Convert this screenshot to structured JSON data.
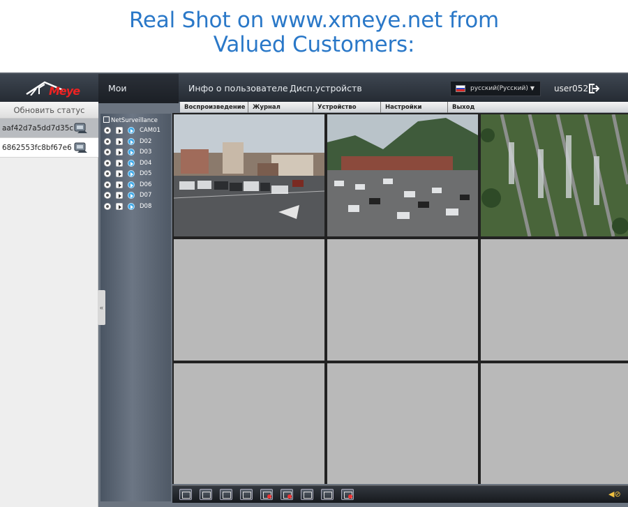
{
  "promo": {
    "line1": "Real Shot on www.xmeye.net from",
    "line2": "Valued Customers:"
  },
  "colors": {
    "promo_text": "#2a78c8",
    "topbar": "#2e343c",
    "active_selection": "#7ec24a",
    "empty_cell": "#b9b9b9"
  },
  "header": {
    "logo_text": "Meye",
    "tabs": [
      {
        "label": "Мои устройства",
        "active": true
      },
      {
        "label": "Инфо о пользователе",
        "active": false
      },
      {
        "label": "Дисп.устройств",
        "active": false
      }
    ],
    "language": "русский(Русский)",
    "username": "user052",
    "separator": "|"
  },
  "submenu": {
    "items": [
      "Воспроизведение",
      "Журнал",
      "Устройство",
      "Настройки",
      "Выход"
    ]
  },
  "devices": {
    "refresh_label": "Обновить статус",
    "items": [
      {
        "id": "aaf42d7a5dd7d35c",
        "selected": true
      },
      {
        "id": "6862553fc8bf67e6",
        "selected": false
      }
    ]
  },
  "tree": {
    "root": "NetSurveillance",
    "channels": [
      "CAM01",
      "D02",
      "D03",
      "D04",
      "D05",
      "D06",
      "D07",
      "D08"
    ],
    "collapse_glyph": "«"
  },
  "grid": {
    "layout": "3x3",
    "active_videos": 3,
    "selected_cell": 1
  },
  "toolbar": {
    "icons": [
      "fullscreen-icon",
      "single-view-icon",
      "quad-view-icon",
      "nine-view-icon",
      "record-icon",
      "stop-record-icon",
      "snapshot-icon",
      "talk-icon",
      "stop-talk-icon"
    ],
    "volume_glyph": "◀⊘"
  }
}
